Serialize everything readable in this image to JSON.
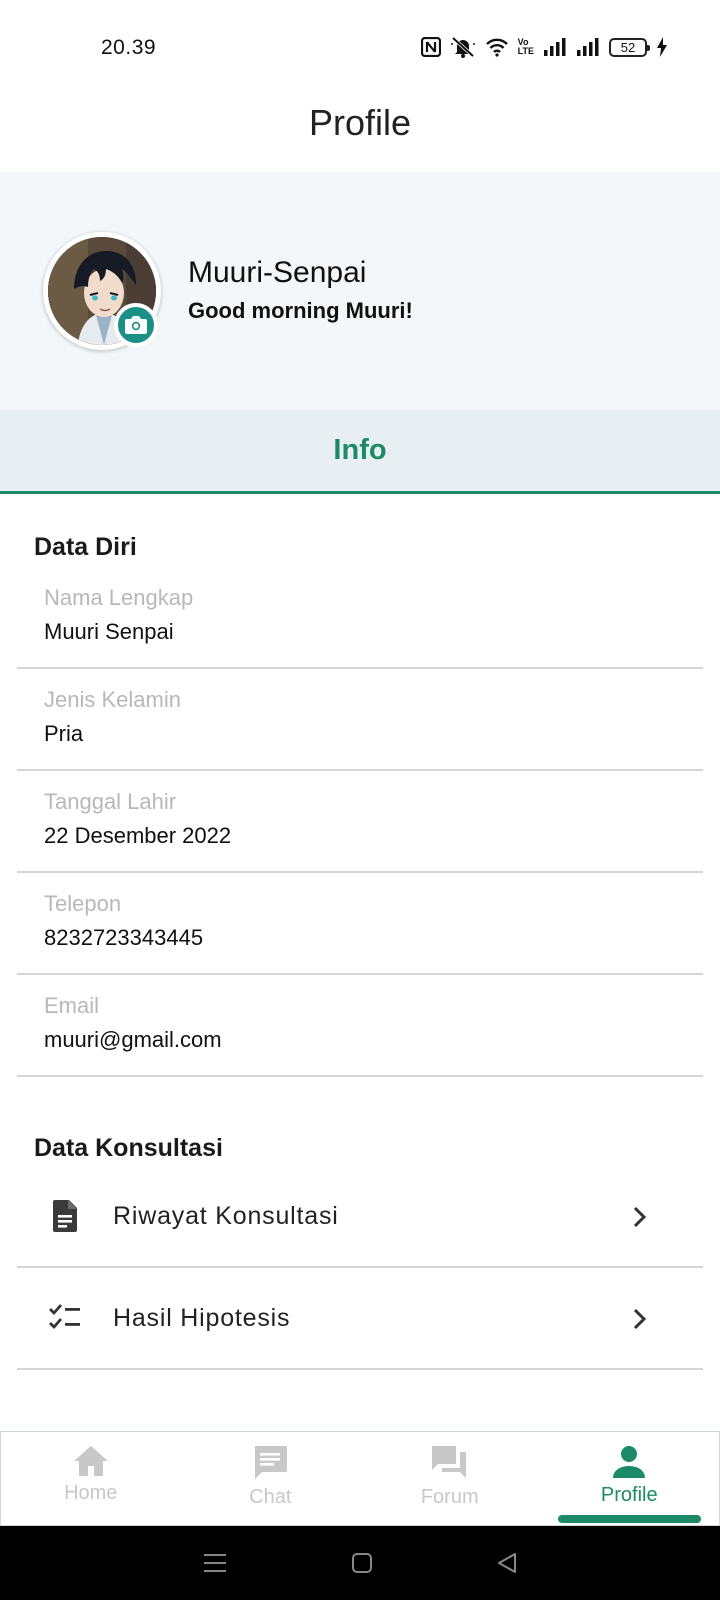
{
  "status_bar": {
    "time": "20.39",
    "battery": "52",
    "volte_line1": "Vo",
    "volte_line2": "LTE"
  },
  "app_bar": {
    "title": "Profile"
  },
  "profile": {
    "name": "Muuri-Senpai",
    "greeting": "Good morning Muuri!"
  },
  "tabs": [
    {
      "label": "Info",
      "active": true
    }
  ],
  "data_diri": {
    "title": "Data Diri",
    "fields": [
      {
        "label": "Nama Lengkap",
        "value": "Muuri Senpai"
      },
      {
        "label": "Jenis Kelamin",
        "value": "Pria"
      },
      {
        "label": "Tanggal Lahir",
        "value": "22 Desember 2022"
      },
      {
        "label": "Telepon",
        "value": "8232723343445"
      },
      {
        "label": "Email",
        "value": "muuri@gmail.com"
      }
    ]
  },
  "data_konsultasi": {
    "title": "Data Konsultasi",
    "items": [
      {
        "label": "Riwayat Konsultasi",
        "icon": "document-icon"
      },
      {
        "label": "Hasil Hipotesis",
        "icon": "checklist-icon"
      }
    ]
  },
  "bottom_nav": {
    "items": [
      {
        "label": "Home",
        "icon": "home-icon",
        "active": false
      },
      {
        "label": "Chat",
        "icon": "chat-icon",
        "active": false
      },
      {
        "label": "Forum",
        "icon": "forum-icon",
        "active": false
      },
      {
        "label": "Profile",
        "icon": "person-icon",
        "active": true
      }
    ]
  },
  "colors": {
    "accent": "#1d8a67",
    "camera_badge": "#1a8f86",
    "header_bg": "#f3f7fa",
    "tab_bg": "#e8eff2",
    "inactive": "#c8c8c8"
  }
}
